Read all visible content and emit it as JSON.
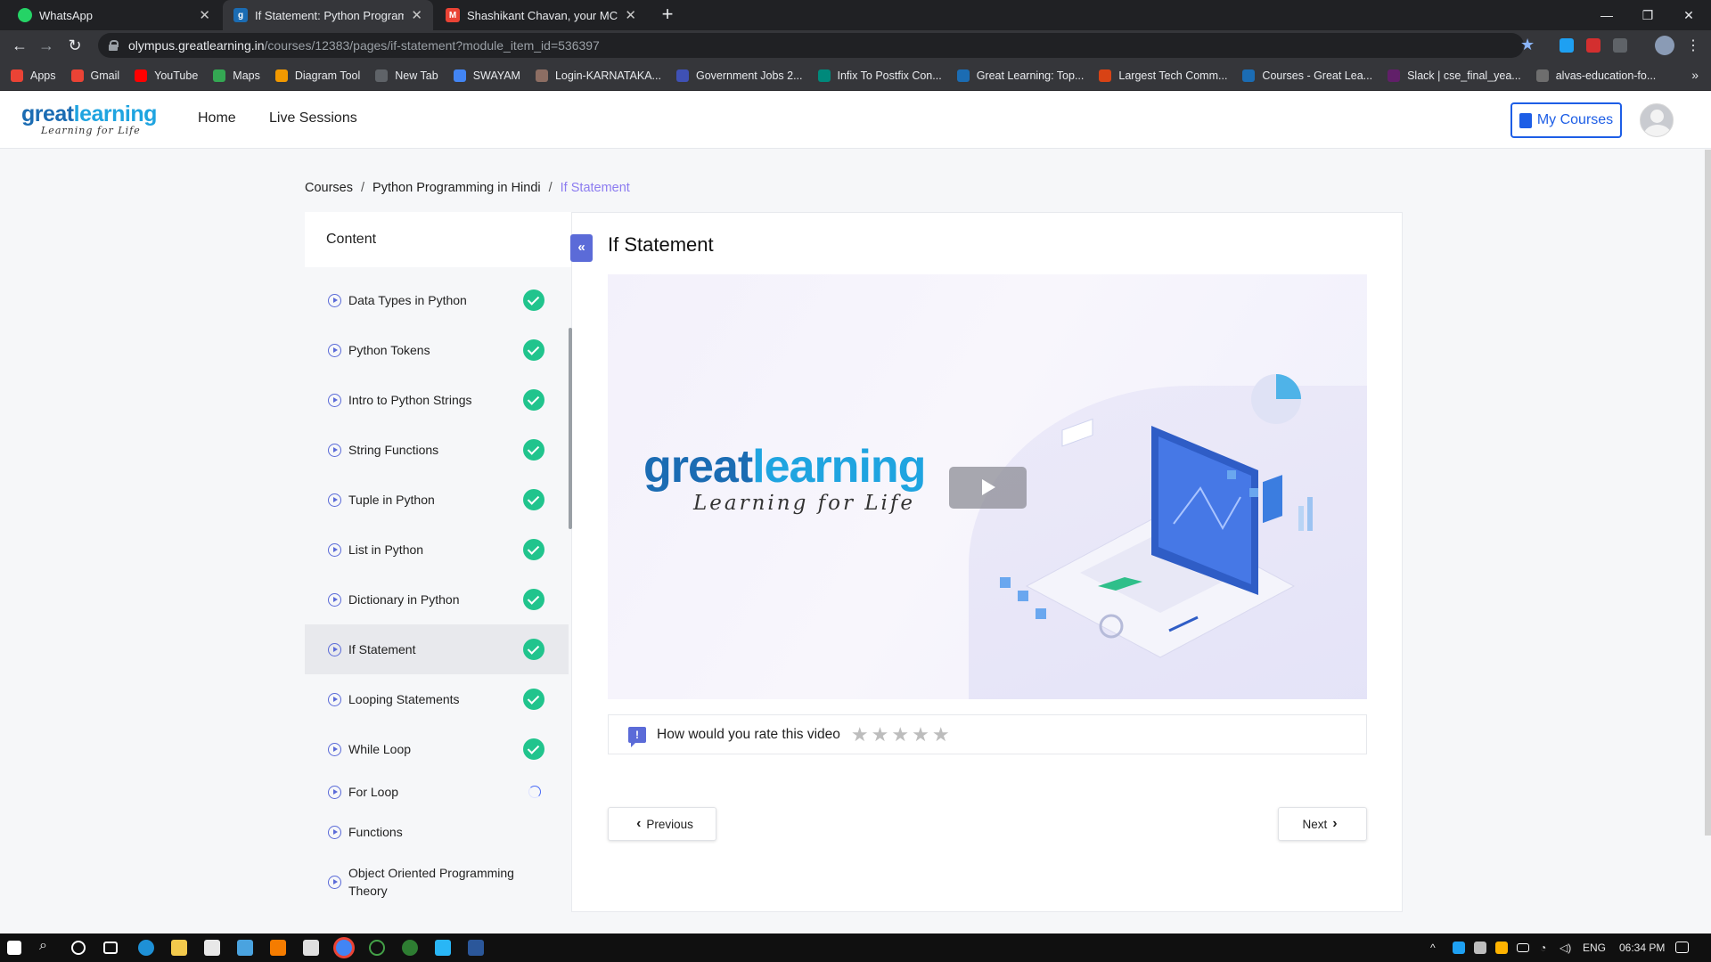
{
  "browser": {
    "tabs": [
      {
        "title": "WhatsApp",
        "icon": "whatsapp-icon",
        "color": "#25d366",
        "active": false
      },
      {
        "title": "If Statement: Python Programming",
        "icon": "greatlearning-icon",
        "color": "#1b6cb3",
        "active": true
      },
      {
        "title": "Shashikant Chavan, your MCQ re",
        "icon": "gmail-icon",
        "color": "#ea4335",
        "active": false
      }
    ],
    "url_host": "olympus.greatlearning.in",
    "url_path": "/courses/12383/pages/if-statement?module_item_id=536397",
    "bookmarks": [
      {
        "label": "Apps",
        "color": "#ea4335"
      },
      {
        "label": "Gmail",
        "color": "#ea4335"
      },
      {
        "label": "YouTube",
        "color": "#ff0000"
      },
      {
        "label": "Maps",
        "color": "#34a853"
      },
      {
        "label": "Diagram Tool",
        "color": "#f29900"
      },
      {
        "label": "New Tab",
        "color": "#5f6368"
      },
      {
        "label": "SWAYAM",
        "color": "#4285f4"
      },
      {
        "label": "Login-KARNATAKA...",
        "color": "#8d6e63"
      },
      {
        "label": "Government Jobs 2...",
        "color": "#3f51b5"
      },
      {
        "label": "Infix To Postfix Con...",
        "color": "#00897b"
      },
      {
        "label": "Great Learning: Top...",
        "color": "#1b6cb3"
      },
      {
        "label": "Largest Tech Comm...",
        "color": "#d84315"
      },
      {
        "label": "Courses - Great Lea...",
        "color": "#1b6cb3"
      },
      {
        "label": "Slack | cse_final_yea...",
        "color": "#611f69"
      },
      {
        "label": "alvas-education-fo...",
        "color": "#6e6e6e"
      }
    ]
  },
  "header": {
    "logo_main_a": "great",
    "logo_main_b": "learning",
    "logo_tagline": "Learning for Life",
    "nav": [
      "Home",
      "Live Sessions"
    ],
    "my_courses": "My Courses"
  },
  "breadcrumb": {
    "items": [
      "Courses",
      "Python Programming in Hindi"
    ],
    "current": "If Statement",
    "separator": "/"
  },
  "sidebar": {
    "title": "Content",
    "items": [
      {
        "label": "Data Types in Python",
        "status": "done"
      },
      {
        "label": "Python Tokens",
        "status": "done"
      },
      {
        "label": "Intro to Python Strings",
        "status": "done"
      },
      {
        "label": "String Functions",
        "status": "done"
      },
      {
        "label": "Tuple in Python",
        "status": "done"
      },
      {
        "label": "List in Python",
        "status": "done"
      },
      {
        "label": "Dictionary in Python",
        "status": "done"
      },
      {
        "label": "If Statement",
        "status": "done",
        "active": true
      },
      {
        "label": "Looping Statements",
        "status": "done"
      },
      {
        "label": "While Loop",
        "status": "done"
      },
      {
        "label": "For Loop",
        "status": "in-progress"
      },
      {
        "label": "Functions",
        "status": "none"
      },
      {
        "label": "Object Oriented Programming Theory",
        "status": "none"
      }
    ]
  },
  "main": {
    "title": "If Statement",
    "video_logo_a": "great",
    "video_logo_b": "learning",
    "video_tagline": "Learning for Life",
    "rating_prompt": "How would you rate this video",
    "rating_value": 0,
    "rating_max": 5,
    "previous_label": "Previous",
    "next_label": "Next"
  },
  "taskbar": {
    "language": "ENG",
    "time": "06:34 PM"
  },
  "colors": {
    "accent": "#5b6bd8",
    "success": "#21c48d",
    "link_blue": "#1d5ee6",
    "breadcrumb_current": "#8c7cf0"
  }
}
